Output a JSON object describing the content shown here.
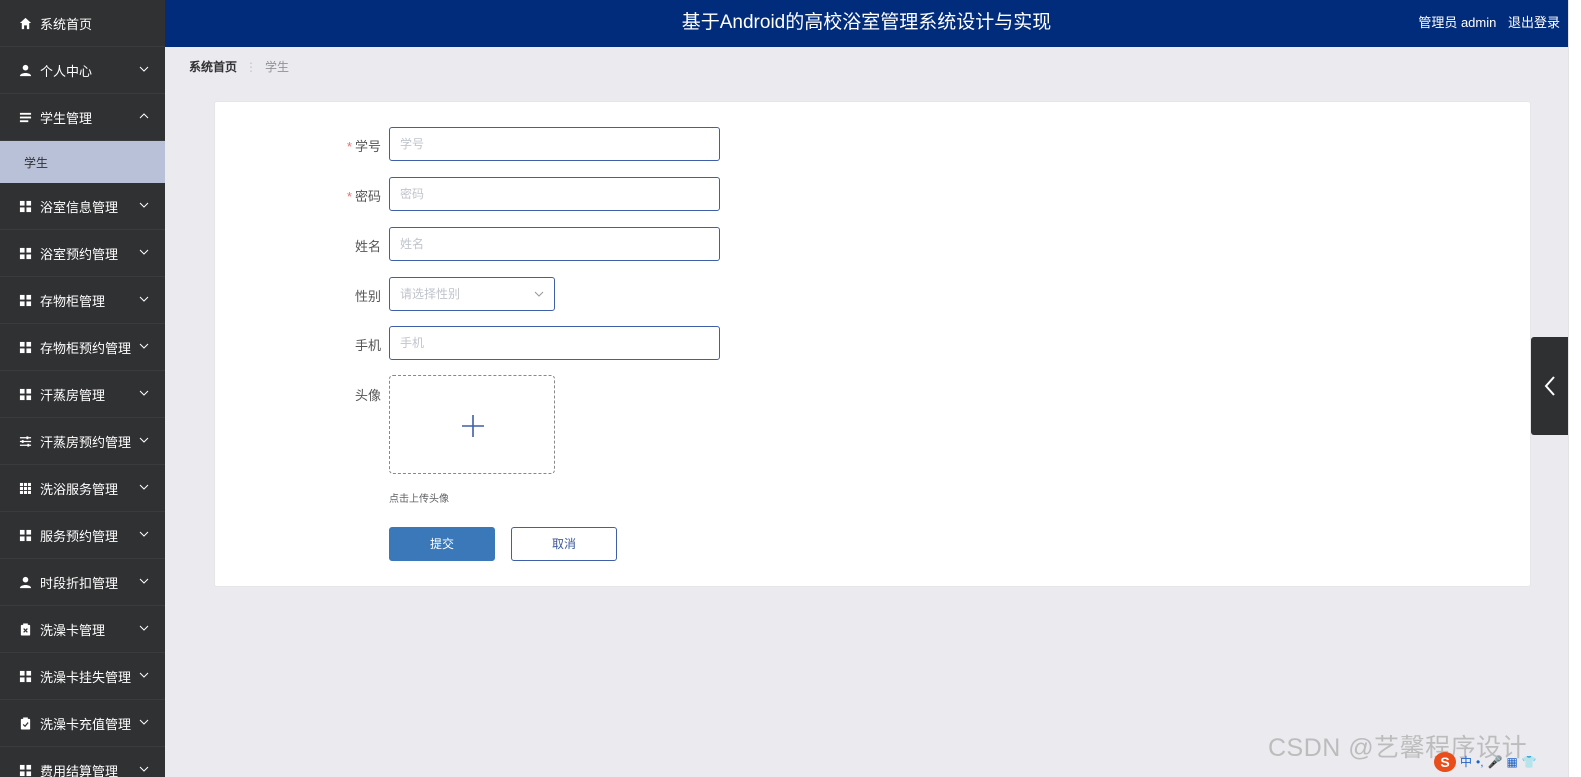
{
  "header": {
    "title": "基于Android的高校浴室管理系统设计与实现",
    "user": "管理员 admin",
    "logout": "退出登录"
  },
  "sidebar": {
    "items": [
      {
        "label": "系统首页",
        "icon": "home-icon",
        "arrow": ""
      },
      {
        "label": "个人中心",
        "icon": "person-icon",
        "arrow": "down"
      },
      {
        "label": "学生管理",
        "icon": "list-icon",
        "arrow": "up"
      },
      {
        "label": "学生",
        "sub": true
      },
      {
        "label": "浴室信息管理",
        "icon": "grid-icon",
        "arrow": "down"
      },
      {
        "label": "浴室预约管理",
        "icon": "grid-icon",
        "arrow": "down"
      },
      {
        "label": "存物柜管理",
        "icon": "grid-icon",
        "arrow": "down"
      },
      {
        "label": "存物柜预约管理",
        "icon": "grid-icon",
        "arrow": "down"
      },
      {
        "label": "汗蒸房管理",
        "icon": "grid-icon",
        "arrow": "down"
      },
      {
        "label": "汗蒸房预约管理",
        "icon": "sliders-icon",
        "arrow": "down"
      },
      {
        "label": "洗浴服务管理",
        "icon": "table-icon",
        "arrow": "down"
      },
      {
        "label": "服务预约管理",
        "icon": "grid-icon",
        "arrow": "down"
      },
      {
        "label": "时段折扣管理",
        "icon": "person-icon",
        "arrow": "down"
      },
      {
        "label": "洗澡卡管理",
        "icon": "clipboard-x-icon",
        "arrow": "down"
      },
      {
        "label": "洗澡卡挂失管理",
        "icon": "grid-icon",
        "arrow": "down"
      },
      {
        "label": "洗澡卡充值管理",
        "icon": "clipboard-check-icon",
        "arrow": "down"
      },
      {
        "label": "费用结算管理",
        "icon": "grid-icon",
        "arrow": "down"
      }
    ]
  },
  "breadcrumb": {
    "home": "系统首页",
    "current": "学生"
  },
  "form": {
    "student_no": {
      "label": "学号",
      "placeholder": "学号",
      "required": true
    },
    "password": {
      "label": "密码",
      "placeholder": "密码",
      "required": true
    },
    "name": {
      "label": "姓名",
      "placeholder": "姓名"
    },
    "gender": {
      "label": "性别",
      "placeholder": "请选择性别"
    },
    "phone": {
      "label": "手机",
      "placeholder": "手机"
    },
    "avatar": {
      "label": "头像",
      "tip": "点击上传头像"
    },
    "submit": "提交",
    "cancel": "取消"
  },
  "watermark": "CSDN @艺馨程序设计",
  "ime": {
    "lang": "中",
    "punct": "•,"
  },
  "colors": {
    "header_bg": "#012c7c",
    "sidebar_bg": "#303133",
    "sidebar_active_bg": "#b9c1d8",
    "primary_button": "#3a78b9",
    "required_mark": "#f56c6c"
  }
}
